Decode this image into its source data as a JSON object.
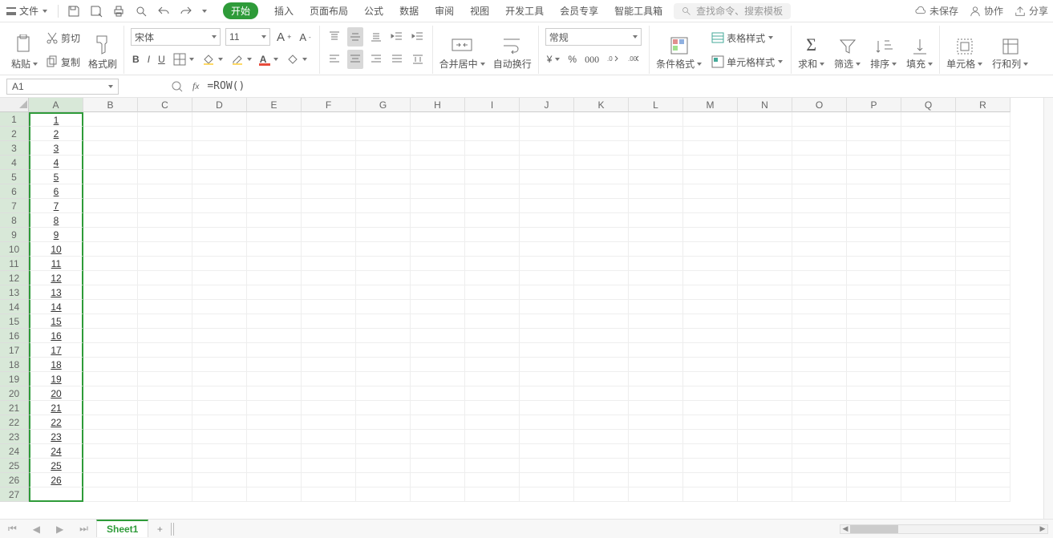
{
  "menu": {
    "file": "文件",
    "tabs": [
      "开始",
      "插入",
      "页面布局",
      "公式",
      "数据",
      "审阅",
      "视图",
      "开发工具",
      "会员专享",
      "智能工具箱"
    ],
    "active_tab": "开始",
    "search_placeholder": "查找命令、搜索模板"
  },
  "right": {
    "unsaved": "未保存",
    "coop": "协作",
    "share": "分享"
  },
  "clipboard": {
    "cut": "剪切",
    "copy": "复制",
    "paste": "粘贴",
    "format_painter": "格式刷"
  },
  "font": {
    "name": "宋体",
    "size": "11"
  },
  "align": {
    "merge": "合并居中",
    "wrap": "自动换行"
  },
  "number": {
    "format": "常规"
  },
  "styles": {
    "cond": "条件格式",
    "tablestyle": "表格样式",
    "cellstyle": "单元格样式"
  },
  "calc": {
    "sum": "求和",
    "filter": "筛选",
    "sort": "排序",
    "fill": "填充"
  },
  "cells": {
    "cells": "单元格",
    "rowscols": "行和列"
  },
  "formulabar": {
    "name": "A1",
    "formula": "=ROW()"
  },
  "columns": [
    "A",
    "B",
    "C",
    "D",
    "E",
    "F",
    "G",
    "H",
    "I",
    "J",
    "K",
    "L",
    "M",
    "N",
    "O",
    "P",
    "Q",
    "R"
  ],
  "rowcount": 27,
  "dataA": [
    1,
    2,
    3,
    4,
    5,
    6,
    7,
    8,
    9,
    10,
    11,
    12,
    13,
    14,
    15,
    16,
    17,
    18,
    19,
    20,
    21,
    22,
    23,
    24,
    25,
    26,
    ""
  ],
  "sheet": {
    "name": "Sheet1"
  }
}
